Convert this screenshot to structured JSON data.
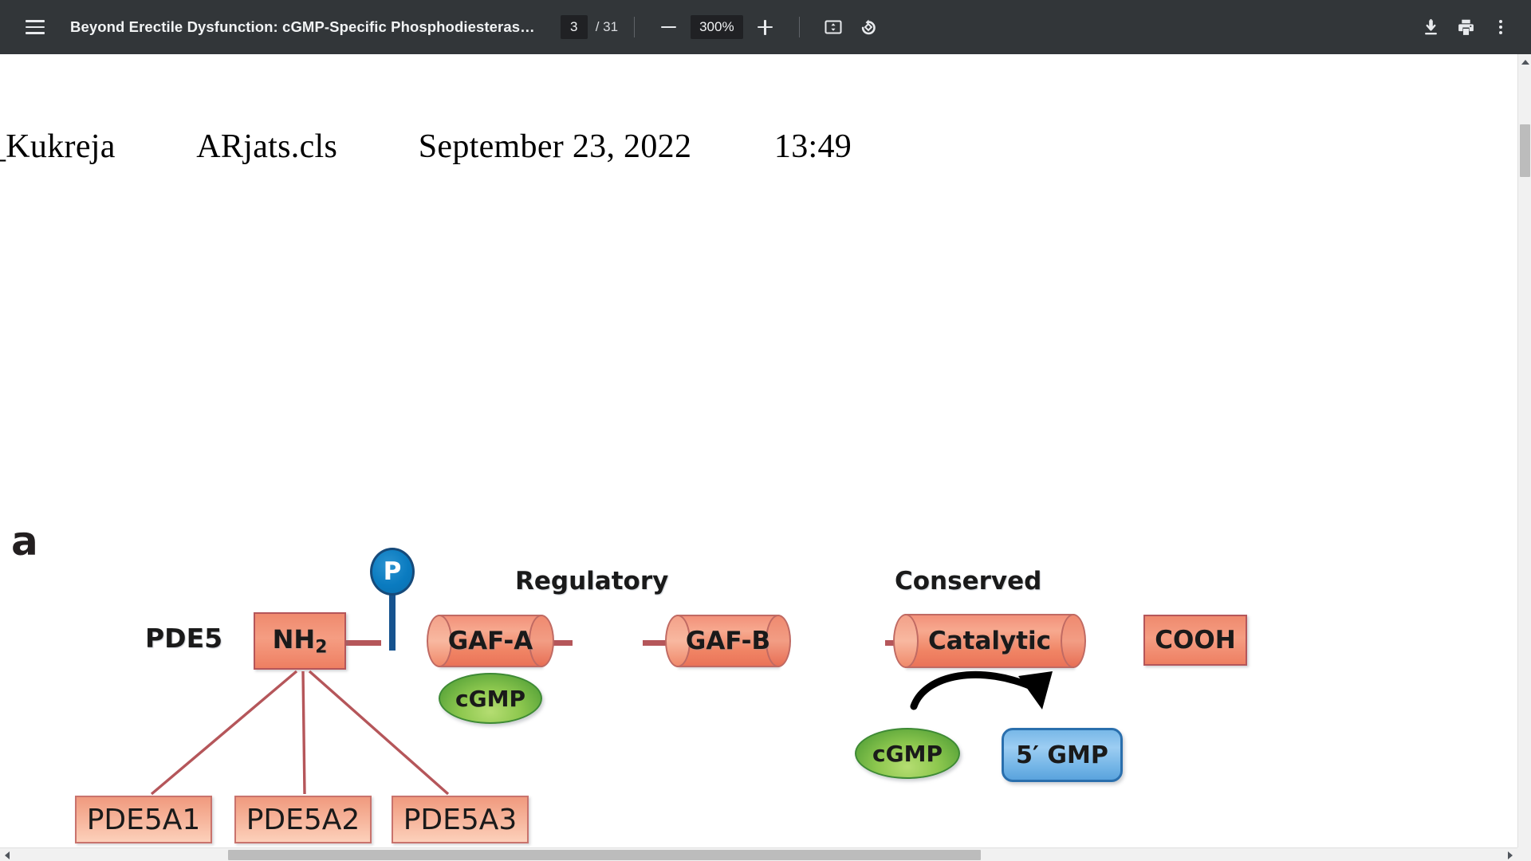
{
  "toolbar": {
    "menu_icon": "hamburger-menu-icon",
    "document_title": "Beyond Erectile Dysfunction: cGMP-Specific Phosphodiesteras…",
    "page_current": "3",
    "page_total": "/ 31",
    "zoom_out_icon": "minus-icon",
    "zoom_level": "300%",
    "zoom_in_icon": "plus-icon",
    "fit_page_icon": "fit-to-page-icon",
    "rotate_icon": "rotate-counterclockwise-icon",
    "download_icon": "download-icon",
    "print_icon": "print-icon",
    "more_icon": "more-vertical-icon",
    "accent_bg": "#323639",
    "field_bg": "#202124"
  },
  "document": {
    "header_line": {
      "author": "_Kukreja",
      "class_file": "ARjats.cls",
      "date": "September 23, 2022",
      "time": "13:49"
    },
    "figure": {
      "panel_letter": "a",
      "protein_label": "PDE5",
      "region_labels": {
        "regulatory": "Regulatory",
        "conserved": "Conserved"
      },
      "domains": {
        "n_terminus": "NH",
        "n_terminus_sub": "2",
        "gaf_a": "GAF-A",
        "gaf_b": "GAF-B",
        "catalytic": "Catalytic",
        "c_terminus": "COOH"
      },
      "phospho_site": "P",
      "ligands": {
        "cgmp_gaf": "cGMP",
        "cgmp_substrate": "cGMP",
        "gmp_product": "5′ GMP"
      },
      "isoforms": [
        "PDE5A1",
        "PDE5A2",
        "PDE5A3"
      ],
      "colors": {
        "domain_fill": "#f59d82",
        "domain_border": "#b5565a",
        "backbone": "#b5565a",
        "cgmp_green": "#8ec84f",
        "gmp_blue": "#9ccdf2",
        "gmp_border": "#2a6fad",
        "phospho_blue": "#0a7bc0",
        "isoform_fill": "#f7b79e",
        "arrow": "#000000"
      }
    }
  },
  "scrollbars": {
    "vertical_up_icon": "scroll-arrow-up-icon",
    "horizontal_left_icon": "scroll-arrow-left-icon",
    "horizontal_right_icon": "scroll-arrow-right-icon"
  }
}
